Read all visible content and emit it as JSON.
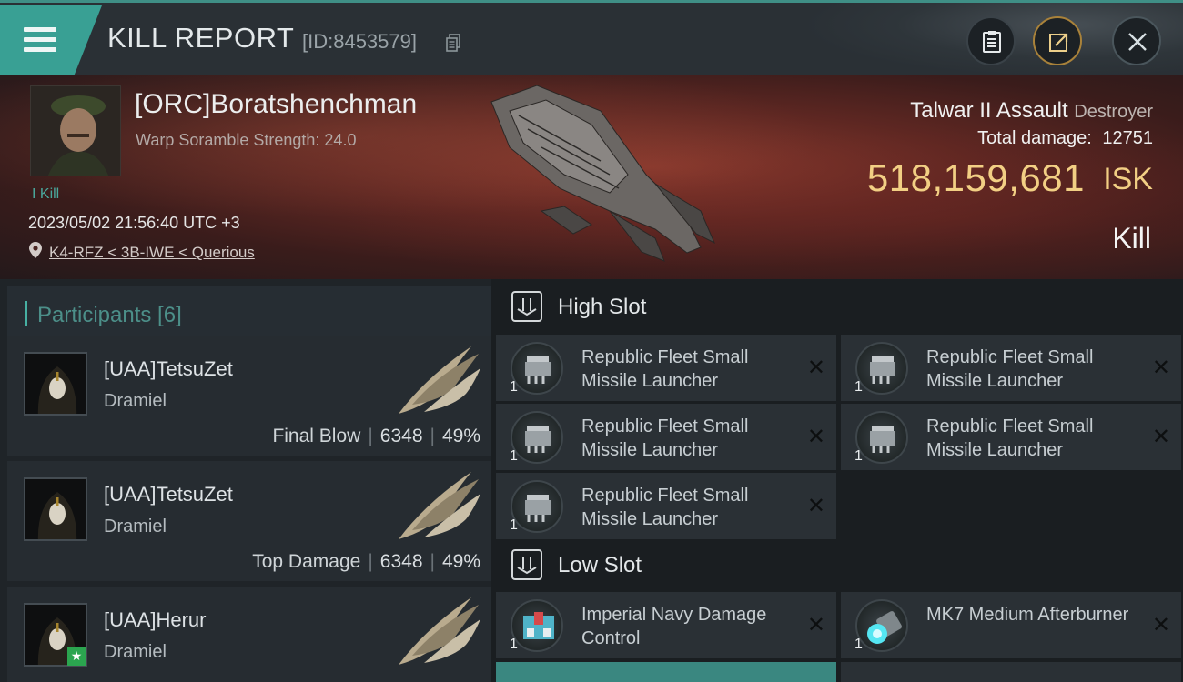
{
  "header": {
    "title": "KILL REPORT",
    "report_id": "[ID:8453579]"
  },
  "victim": {
    "name": "[ORC]Boratshenchman",
    "warp_scramble": "Warp Soramble Strength: 24.0",
    "kill_count": "I Kill",
    "timestamp": "2023/05/02 21:56:40 UTC +3",
    "location": "K4-RFZ < 3B-IWE < Querious",
    "ship_name": "Talwar II Assault",
    "ship_class": "Destroyer",
    "total_damage_label": "Total damage:",
    "total_damage": "12751",
    "isk_value": "518,159,681",
    "isk_unit": "ISK",
    "result": "Kill"
  },
  "participants": {
    "title": "Participants [6]",
    "rows": [
      {
        "name": "[UAA]TetsuZet",
        "ship": "Dramiel",
        "label": "Final Blow",
        "damage": "6348",
        "percent": "49%"
      },
      {
        "name": "[UAA]TetsuZet",
        "ship": "Dramiel",
        "label": "Top Damage",
        "damage": "6348",
        "percent": "49%"
      },
      {
        "name": "[UAA]Herur",
        "ship": "Dramiel",
        "label": "",
        "damage": "",
        "percent": ""
      }
    ]
  },
  "fittings": {
    "high_slot": {
      "title": "High Slot",
      "modules": [
        {
          "name": "Republic Fleet Small Missile Launcher",
          "qty": "1"
        },
        {
          "name": "Republic Fleet Small Missile Launcher",
          "qty": "1"
        },
        {
          "name": "Republic Fleet Small Missile Launcher",
          "qty": "1"
        },
        {
          "name": "Republic Fleet Small Missile Launcher",
          "qty": "1"
        },
        {
          "name": "Republic Fleet Small Missile Launcher",
          "qty": "1"
        }
      ]
    },
    "low_slot": {
      "title": "Low Slot",
      "modules": [
        {
          "name": "Imperial Navy Damage Control",
          "qty": "1"
        },
        {
          "name": "MK7 Medium Afterburner",
          "qty": "1"
        }
      ]
    },
    "remove_glyph": "✕"
  },
  "colors": {
    "accent": "#39a094",
    "isk": "#f2cf84",
    "banner": "#5e2722",
    "panel": "#2a3035"
  },
  "icons": [
    "menu-icon",
    "copy-icon",
    "clipboard-icon",
    "share-icon",
    "close-icon",
    "location-pin-icon",
    "slot-icon",
    "star-icon"
  ]
}
